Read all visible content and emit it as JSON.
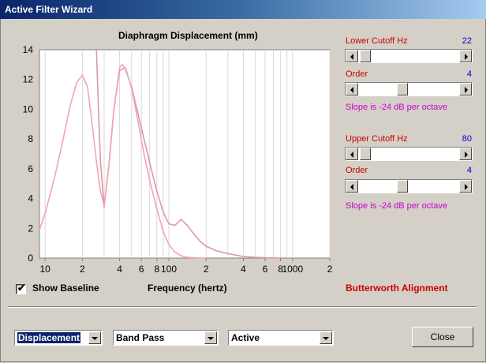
{
  "window": {
    "title": "Active Filter Wizard"
  },
  "chart_data": {
    "type": "line",
    "title": "Diaphragm Displacement (mm)",
    "xlabel": "Frequency (hertz)",
    "ylabel": "",
    "x_scale": "log",
    "xlim": [
      9,
      2000
    ],
    "ylim": [
      0,
      14
    ],
    "y_ticks": [
      "0",
      "2",
      "4",
      "6",
      "8",
      "10",
      "12",
      "14"
    ],
    "x_ticks": [
      {
        "value": 10,
        "label": "10"
      },
      {
        "value": 20,
        "label": "2"
      },
      {
        "value": 40,
        "label": "4"
      },
      {
        "value": 60,
        "label": "6"
      },
      {
        "value": 80,
        "label": "8"
      },
      {
        "value": 100,
        "label": "100"
      },
      {
        "value": 200,
        "label": "2"
      },
      {
        "value": 400,
        "label": "4"
      },
      {
        "value": 600,
        "label": "6"
      },
      {
        "value": 800,
        "label": "8"
      },
      {
        "value": 1000,
        "label": "1000"
      },
      {
        "value": 2000,
        "label": "2"
      }
    ],
    "grid": true,
    "series": [
      {
        "color": "#d89aa8",
        "x": [
          26,
          27,
          28,
          30,
          33,
          36,
          40,
          44,
          50,
          56,
          63,
          71,
          80,
          90,
          100,
          112,
          126,
          141,
          160,
          180,
          200,
          240,
          300,
          400,
          500,
          600,
          800
        ],
        "y": [
          14,
          10,
          6.5,
          3.4,
          6.5,
          10,
          12.6,
          12.8,
          11.5,
          9.8,
          8,
          6.2,
          4.5,
          3.1,
          2.3,
          2.2,
          2.6,
          2.2,
          1.6,
          1.1,
          0.8,
          0.5,
          0.3,
          0.1,
          0.05,
          0.02,
          0
        ]
      },
      {
        "color": "#f4a4b4",
        "x": [
          9,
          10,
          12,
          14,
          16,
          18,
          20,
          22,
          24,
          26,
          28,
          30,
          33,
          36,
          40,
          42,
          45,
          50,
          56,
          63,
          71,
          80,
          90,
          100,
          112,
          126,
          141,
          160,
          180,
          200
        ],
        "y": [
          1.9,
          3,
          5.5,
          8,
          10.3,
          11.8,
          12.3,
          11.5,
          9,
          6.5,
          4.5,
          3.5,
          6.5,
          10,
          12.8,
          13,
          12.7,
          11.4,
          9.3,
          7,
          5,
          3.3,
          1.8,
          0.9,
          0.4,
          0.15,
          0.05,
          0.02,
          0,
          0
        ]
      }
    ]
  },
  "controls": {
    "lower_cutoff_label": "Lower Cutoff  Hz",
    "lower_cutoff_value": "22",
    "lower_cutoff_pos": 0.02,
    "lower_order_label": "Order",
    "lower_order_value": "4",
    "lower_order_pos": 0.43,
    "lower_slope": "Slope is -24 dB per octave",
    "upper_cutoff_label": "Upper Cutoff  Hz",
    "upper_cutoff_value": "80",
    "upper_cutoff_pos": 0.02,
    "upper_order_label": "Order",
    "upper_order_value": "4",
    "upper_order_pos": 0.43,
    "upper_slope": "Slope is -24 dB per octave"
  },
  "baseline": {
    "label": "Show Baseline",
    "checked": true,
    "check_mark": "✔"
  },
  "alignment": "Butterworth Alignment",
  "bottom": {
    "view_select": "Displacement",
    "filter_select": "Band Pass",
    "mode_select": "Active",
    "close_label": "Close"
  }
}
